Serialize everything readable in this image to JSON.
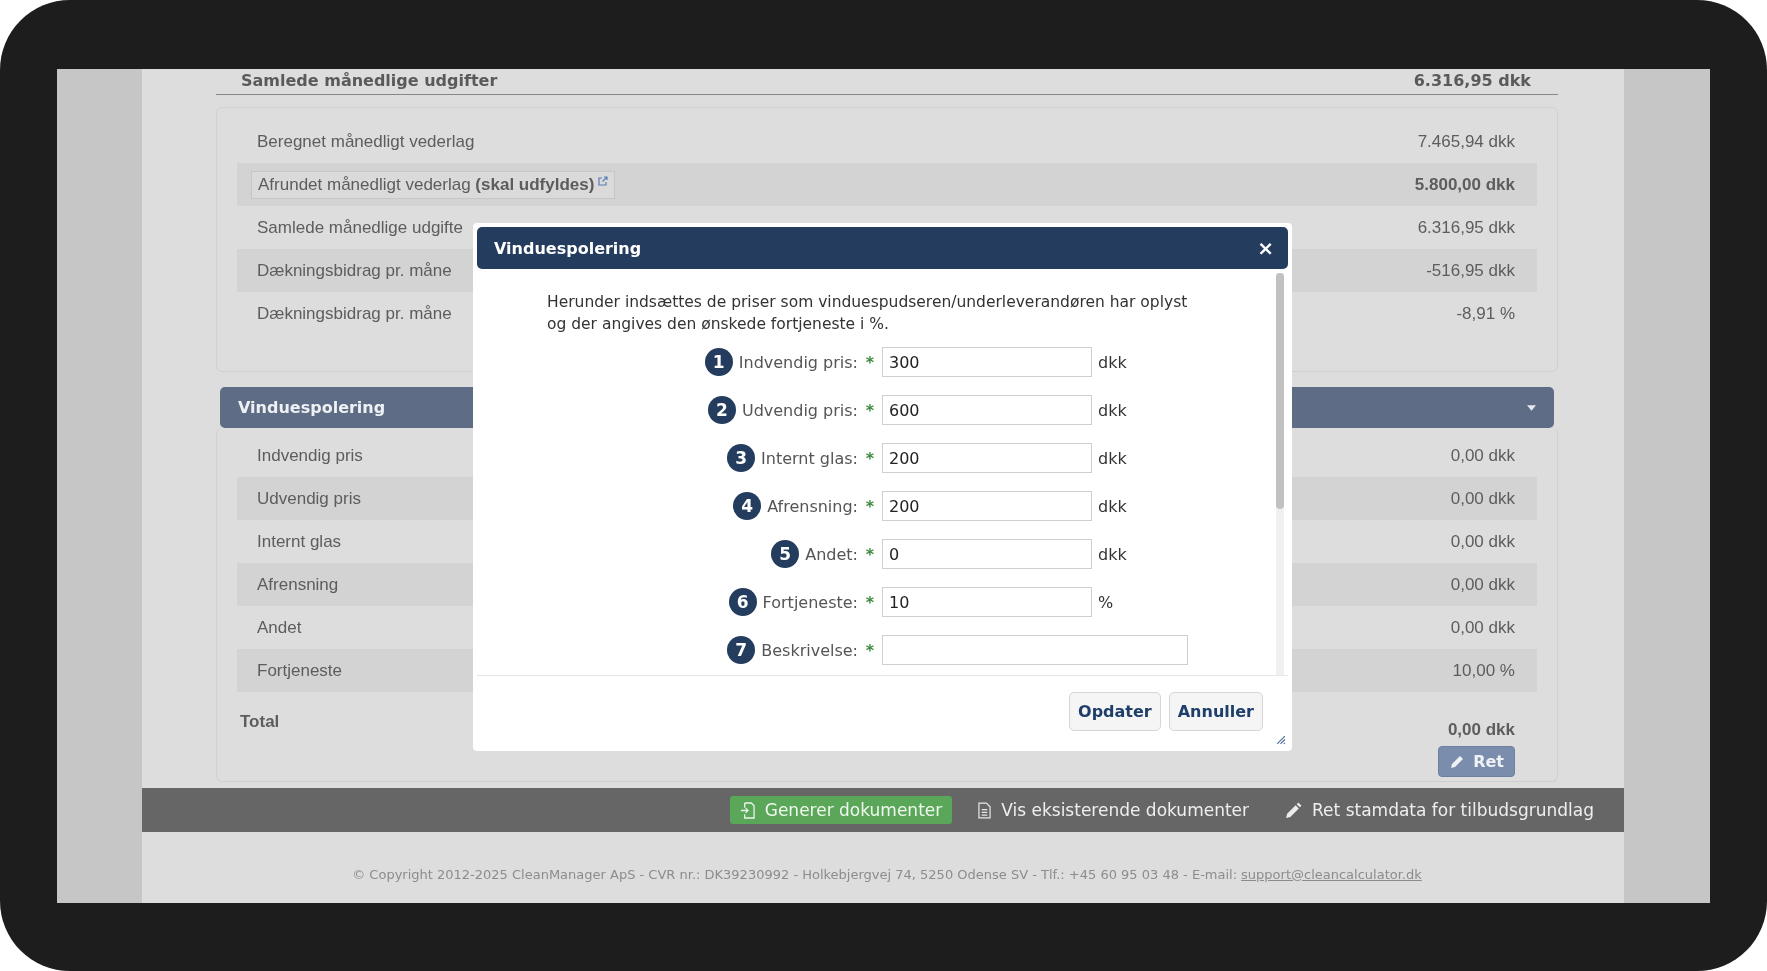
{
  "top_total": {
    "label": "Samlede månedlige udgifter",
    "value": "6.316,95 dkk"
  },
  "summary_rows": [
    {
      "kind": "plain",
      "label": "Beregnet månedligt vederlag",
      "value": "7.465,94 dkk",
      "emphasis": false
    },
    {
      "kind": "boxed",
      "label": "Afrundet månedligt vederlag **(skal udfyldes)**",
      "value": "5.800,00 dkk",
      "emphasis": true
    },
    {
      "kind": "plain",
      "label": "Samlede månedlige udgifte",
      "value": "6.316,95 dkk",
      "emphasis": false
    },
    {
      "kind": "plain",
      "label": "Dækningsbidrag pr. måne",
      "value": "-516,95 dkk",
      "emphasis": false
    },
    {
      "kind": "plain",
      "label": "Dækningsbidrag pr. måne",
      "value": "-8,91 %",
      "emphasis": false
    }
  ],
  "section": {
    "title": "Vinduespolering",
    "expanded": true,
    "rows": [
      {
        "label": "Indvendig pris",
        "value": "0,00 dkk"
      },
      {
        "label": "Udvendig pris",
        "value": "0,00 dkk"
      },
      {
        "label": "Internt glas",
        "value": "0,00 dkk"
      },
      {
        "label": "Afrensning",
        "value": "0,00 dkk"
      },
      {
        "label": "Andet",
        "value": "0,00 dkk"
      },
      {
        "label": "Fortjeneste",
        "value": "10,00 %"
      }
    ],
    "total": {
      "label": "Total",
      "value": "0,00 dkk"
    },
    "edit_button": "Ret"
  },
  "action_bar": [
    {
      "kind": "generate",
      "label": "Generer dokumenter"
    },
    {
      "kind": "documents",
      "label": "Vis eksisterende dokumenter"
    },
    {
      "kind": "edit",
      "label": "Ret stamdata for tilbudsgrundlag"
    }
  ],
  "footer": {
    "text": "© Copyright 2012-2025 CleanManager ApS - CVR nr.: DK39230992 - Holkebjergvej 74, 5250 Odense SV - Tlf.: +45 60 95 03 48 - E-mail:",
    "link": "support@cleancalculator.dk"
  },
  "dialog": {
    "title": "Vinduespolering",
    "close": "×",
    "intro": "Herunder indsættes de priser som vinduespudseren/underleverandøren har oplyst og der angives den ønskede fortjeneste i %.",
    "fields": [
      {
        "number": "1",
        "label": "Indvendig pris:",
        "required": true,
        "value": "300",
        "unit": "dkk"
      },
      {
        "number": "2",
        "label": "Udvendig pris:",
        "required": true,
        "value": "600",
        "unit": "dkk"
      },
      {
        "number": "3",
        "label": "Internt glas:",
        "required": true,
        "value": "200",
        "unit": "dkk"
      },
      {
        "number": "4",
        "label": "Afrensning:",
        "required": true,
        "value": "200",
        "unit": "dkk"
      },
      {
        "number": "5",
        "label": "Andet:",
        "required": true,
        "value": "0",
        "unit": "dkk"
      },
      {
        "number": "6",
        "label": "Fortjeneste:",
        "required": true,
        "value": "10",
        "unit": "%"
      },
      {
        "number": "7",
        "label": "Beskrivelse:",
        "required": true,
        "kind": "wide"
      }
    ],
    "required_mark": "*",
    "buttons": [
      "Opdater",
      "Annuller"
    ]
  }
}
